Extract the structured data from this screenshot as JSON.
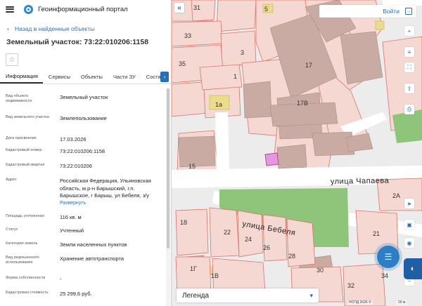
{
  "header": {
    "portal_title": "Геоинформационный портал"
  },
  "panel": {
    "back_link": "Назад в найденные объекты",
    "title": "Земельный участок: 73:22:010206:1158",
    "tabs": [
      "Информация",
      "Сервисы",
      "Объекты",
      "Части ЗУ",
      "Соста"
    ],
    "active_tab": 0,
    "rows": [
      {
        "label": "Вид объекта недвижимости",
        "value": "Земельный участок"
      },
      {
        "label": "Вид земельного участка",
        "value": "Землепользование"
      },
      {
        "label": "Дата присвоения",
        "value": "17.03.2026"
      },
      {
        "label": "Кадастровый номер",
        "value": "73:22:010206:1158"
      },
      {
        "label": "Кадастровый квартал",
        "value": "73:22:010206"
      },
      {
        "label": "Адрес",
        "value": "Российская Федерация, Ульяновская область, м.р-н Барышский, г.п. Барышское, г Барыш, ул Бебеля, з/у",
        "more": "Развернуть"
      },
      {
        "label": "Площадь уточненная",
        "value": "116 кв. м"
      },
      {
        "label": "Статус",
        "value": "Учтенный"
      },
      {
        "label": "Категория земель",
        "value": "Земли населенных пунктов"
      },
      {
        "label": "Вид разрешенного использования",
        "value": "Хранение автотранспорта"
      },
      {
        "label": "Форма собственности",
        "value": "-"
      },
      {
        "label": "Кадастровая стоимость",
        "value": "25 299,6 руб."
      }
    ]
  },
  "map": {
    "login_label": "Войти",
    "legend_label": "Легенда",
    "attribution": "НСПД 2026 ©",
    "scale": "20 м",
    "streets": [
      "улица Чапаева",
      "улица Бебеля"
    ],
    "parcel_labels": [
      "31",
      "5",
      "33",
      "3",
      "35",
      "1",
      "1а",
      "17",
      "17В",
      "15",
      "18",
      "22",
      "24",
      "26",
      "28",
      "1Г",
      "1В",
      "30",
      "32",
      "34",
      "21",
      "2А"
    ],
    "colors": {
      "parcel_fill": "#f6d8d2",
      "parcel_stroke": "#d9736a",
      "building": "#c9aba4",
      "building_dark": "#a89a95",
      "selected": "#e596dc",
      "green": "#8fc57a",
      "road": "#ffffff",
      "yellow": "#e9dc8a"
    }
  }
}
